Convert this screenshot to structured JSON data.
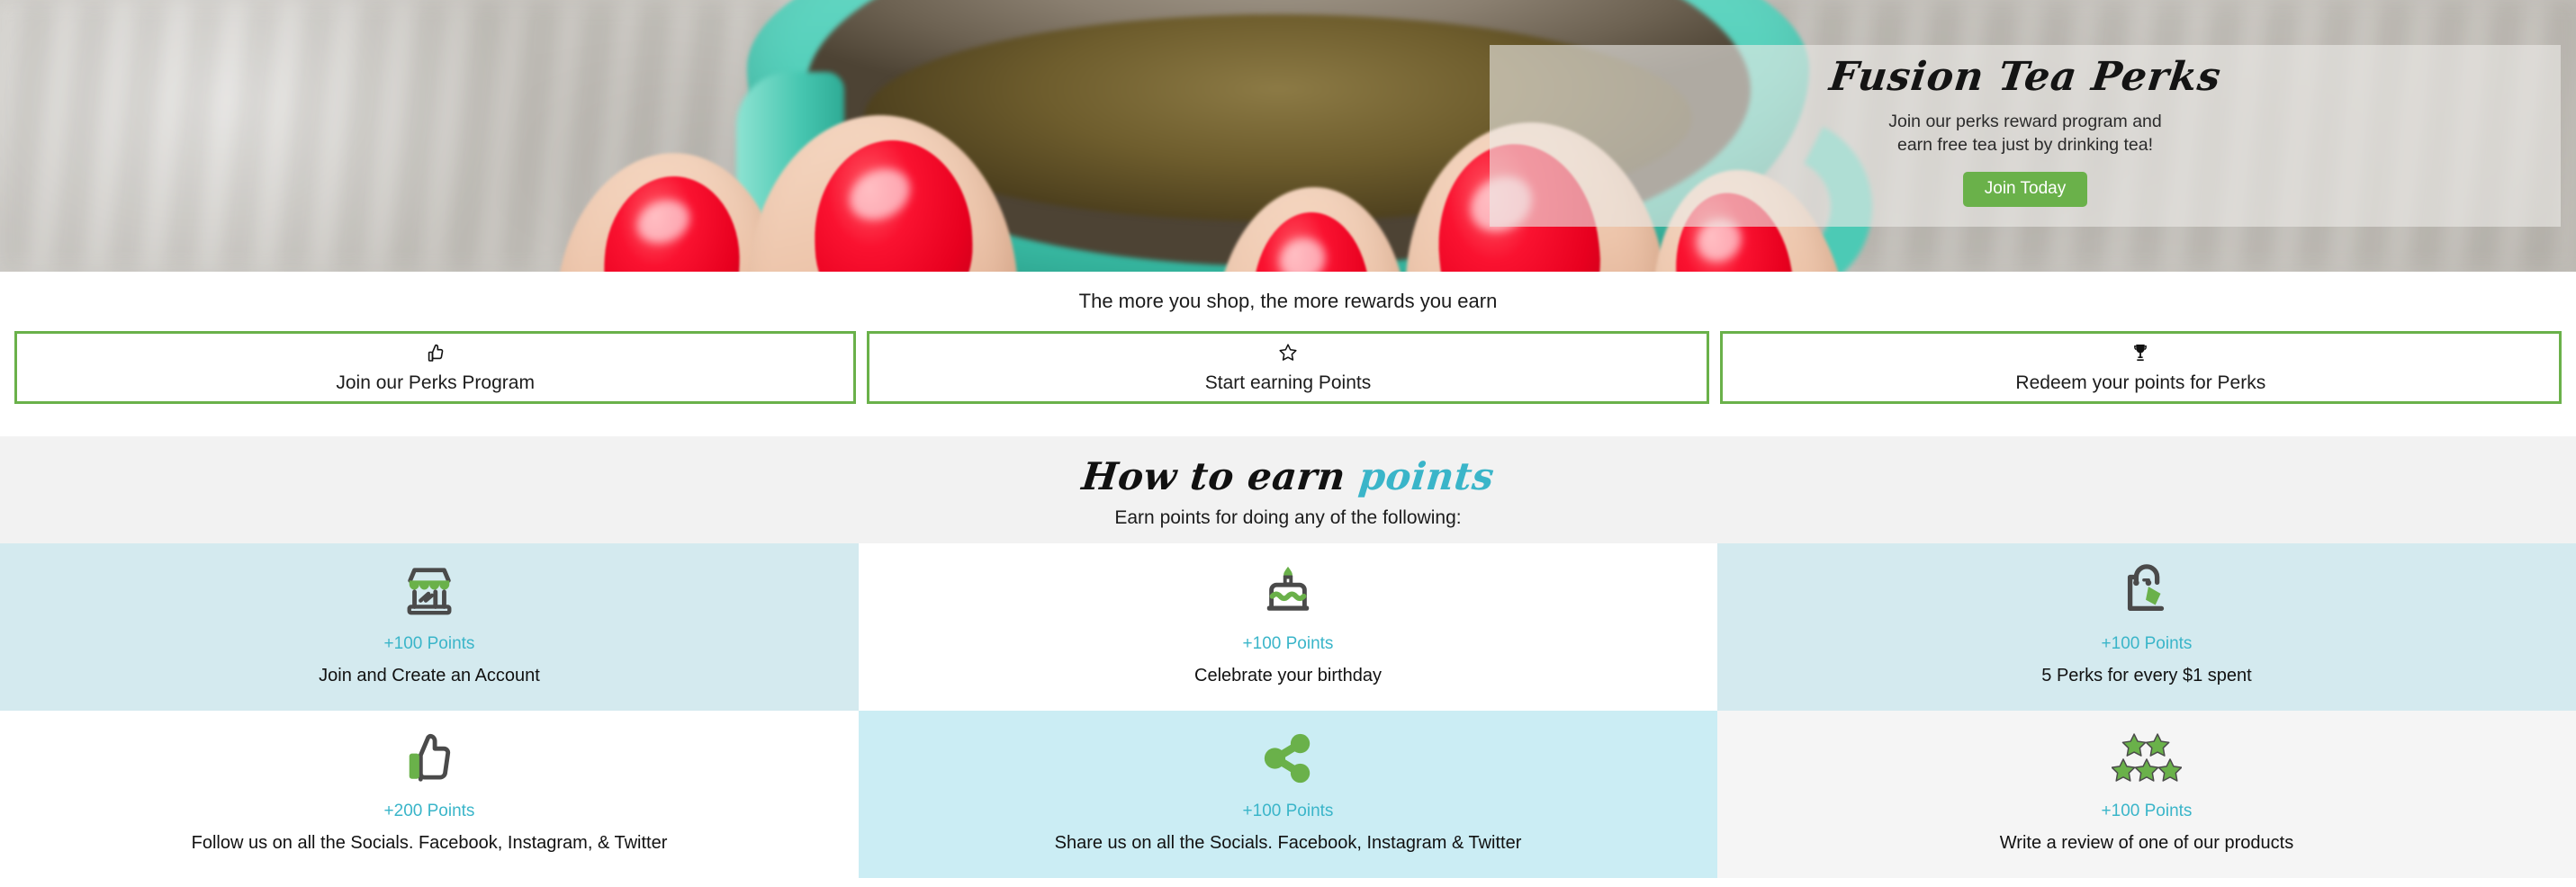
{
  "hero": {
    "title": "Fusion Tea Perks",
    "subtitle_line1": "Join our perks reward program and",
    "subtitle_line2": "earn free tea just by drinking tea!",
    "cta_label": "Join Today",
    "cta_color": "#6ab14a",
    "panel_bg": "rgba(236,234,230,0.62)"
  },
  "tagline": "The more you shop, the more rewards you earn",
  "cards": [
    {
      "icon": "thumbs-up-icon",
      "glyph": "☝",
      "label": "Join our Perks Program"
    },
    {
      "icon": "star-icon",
      "glyph": "☆",
      "label": "Start earning Points"
    },
    {
      "icon": "trophy-icon",
      "glyph": "Ἴ6",
      "label": "Redeem your points for Perks"
    }
  ],
  "cards_border_color": "#6ab14a",
  "earn": {
    "title_main": "How to earn ",
    "title_accent": "points",
    "accent_color": "#3ab5c9",
    "subtitle": "Earn points for doing any of the following:",
    "tiles": [
      {
        "icon": "storefront-icon",
        "points": "+100 Points",
        "desc": "Join and Create an Account",
        "bg": "blue"
      },
      {
        "icon": "birthday-cake-icon",
        "points": "+100 Points",
        "desc": "Celebrate your birthday",
        "bg": "white"
      },
      {
        "icon": "shopping-bag-icon",
        "points": "+100 Points",
        "desc": "5 Perks for every $1 spent",
        "bg": "blue"
      },
      {
        "icon": "thumbs-up-icon",
        "points": "+200 Points",
        "desc": "Follow us on all the Socials. Facebook, Instagram, & Twitter",
        "bg": "white"
      },
      {
        "icon": "share-nodes-icon",
        "points": "+100 Points",
        "desc": "Share us on all the Socials. Facebook, Instagram & Twitter",
        "bg": "blue2"
      },
      {
        "icon": "five-stars-icon",
        "points": "+100 Points",
        "desc": "Write a review of one of our products",
        "bg": "grey"
      }
    ],
    "icon_dark": "#4a4a4a",
    "icon_green": "#6ab14a"
  }
}
